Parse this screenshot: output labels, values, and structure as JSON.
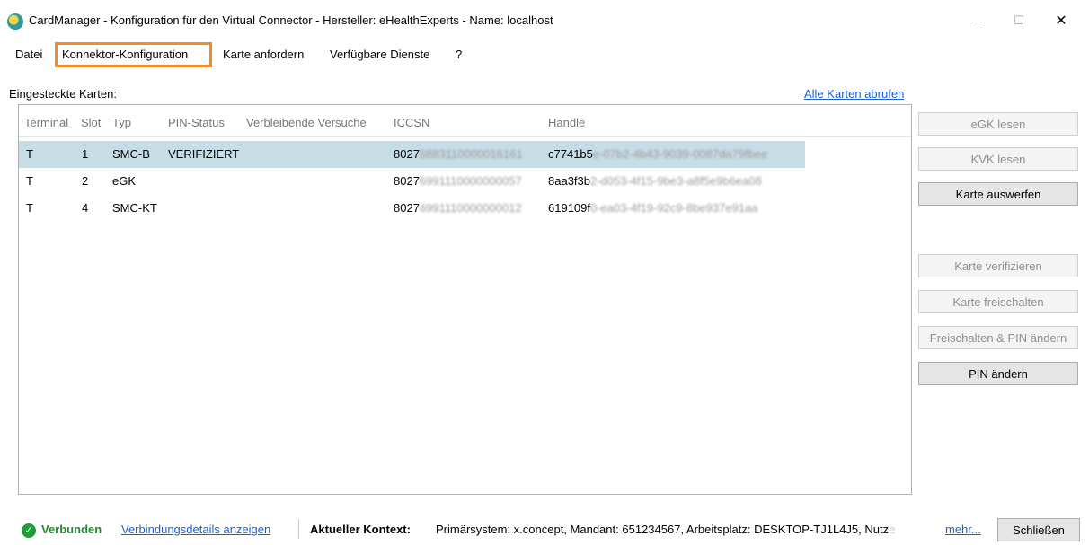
{
  "window": {
    "title": "CardManager - Konfiguration für den Virtual Connector - Hersteller: eHealthExperts - Name: localhost",
    "minimize": "—",
    "maximize": "☐",
    "close": "✕"
  },
  "menu": {
    "items": [
      "Datei",
      "Konnektor-Konfiguration",
      "Karte anfordern",
      "Verfügbare Dienste",
      "?"
    ]
  },
  "cards_section": {
    "label": "Eingesteckte Karten:",
    "fetch_all_link": "Alle Karten abrufen"
  },
  "table": {
    "columns": [
      "Terminal",
      "Slot",
      "Typ",
      "PIN-Status",
      "Verbleibende Versuche",
      "ICCSN",
      "Handle"
    ],
    "rows": [
      {
        "terminal": "T",
        "slot": "1",
        "type": "SMC-B",
        "pin_status": "VERIFIZIERT",
        "remaining": "",
        "iccsn_prefix": "8027",
        "iccsn_blurred": "6883110000016161",
        "handle_prefix": "c7741b5",
        "handle_blurred": "e-07b2-4b43-9039-0087da79fbee",
        "selected": true
      },
      {
        "terminal": "T",
        "slot": "2",
        "type": "eGK",
        "pin_status": "",
        "remaining": "",
        "iccsn_prefix": "8027",
        "iccsn_blurred": "6991110000000057",
        "handle_prefix": "8aa3f3b",
        "handle_blurred": "2-d053-4f15-9be3-a8f5e9b6ea08",
        "selected": false
      },
      {
        "terminal": "T",
        "slot": "4",
        "type": "SMC-KT",
        "pin_status": "",
        "remaining": "",
        "iccsn_prefix": "8027",
        "iccsn_blurred": "6991110000000012",
        "handle_prefix": "619109f",
        "handle_blurred": "0-ea03-4f19-92c9-8be937e91aa",
        "selected": false
      }
    ]
  },
  "side_buttons": [
    {
      "label": "eGK lesen",
      "enabled": false
    },
    {
      "label": "KVK lesen",
      "enabled": false
    },
    {
      "label": "Karte auswerfen",
      "enabled": true
    },
    {
      "label": "Karte verifizieren",
      "enabled": false
    },
    {
      "label": "Karte freischalten",
      "enabled": false
    },
    {
      "label": "Freischalten & PIN ändern",
      "enabled": false
    },
    {
      "label": "PIN ändern",
      "enabled": true
    }
  ],
  "status": {
    "connected": "Verbunden",
    "details_link": "Verbindungsdetails anzeigen",
    "context_label": "Aktueller Kontext:",
    "context_value": "Primärsystem: x.concept, Mandant: 651234567, Arbeitsplatz: DESKTOP-TJ1L4J5, Nutz",
    "context_faded": "e",
    "more_link": "mehr...",
    "close_button": "Schließen"
  },
  "colors": {
    "highlight_border": "#f28c28",
    "selected_row": "#c6dde6",
    "link": "#1a5fd6",
    "connected_green": "#1f8a2e"
  }
}
